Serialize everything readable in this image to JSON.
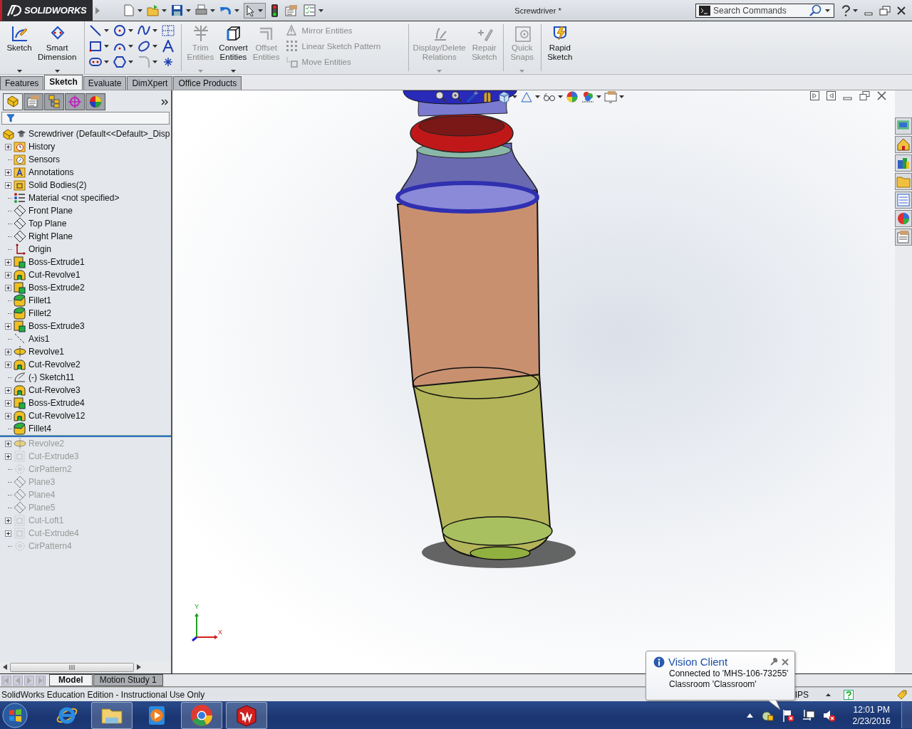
{
  "title_bar": {
    "logo": "SOLIDWORKS",
    "document_title": "Screwdriver *",
    "search": {
      "placeholder": "Search Commands"
    }
  },
  "command_manager": [
    {
      "kind": "large",
      "label": "Sketch",
      "disabled": false,
      "dropdown": true
    },
    {
      "kind": "large",
      "label": "Smart Dimension",
      "disabled": false,
      "dropdown": true
    },
    {
      "kind": "grid"
    },
    {
      "kind": "large",
      "label": "Trim Entities",
      "disabled": true,
      "dropdown": true
    },
    {
      "kind": "large",
      "label": "Convert Entities",
      "disabled": false,
      "dropdown": true
    },
    {
      "kind": "large",
      "label": "Offset Entities",
      "disabled": true,
      "dropdown": false
    },
    {
      "kind": "stack",
      "items": [
        {
          "label": "Mirror Entities",
          "disabled": true
        },
        {
          "label": "Linear Sketch Pattern",
          "disabled": true
        },
        {
          "label": "Move Entities",
          "disabled": true
        }
      ]
    },
    {
      "kind": "large",
      "label": "Display/Delete Relations",
      "disabled": true,
      "dropdown": true
    },
    {
      "kind": "large",
      "label": "Repair Sketch",
      "disabled": true,
      "dropdown": false
    },
    {
      "kind": "large",
      "label": "Quick Snaps",
      "disabled": true,
      "dropdown": true
    },
    {
      "kind": "large",
      "label": "Rapid Sketch",
      "disabled": false,
      "dropdown": false
    }
  ],
  "command_tabs": [
    {
      "label": "Features",
      "selected": false
    },
    {
      "label": "Sketch",
      "selected": true
    },
    {
      "label": "Evaluate",
      "selected": false
    },
    {
      "label": "DimXpert",
      "selected": false
    },
    {
      "label": "Office Products",
      "selected": false
    }
  ],
  "panel_tabs": [
    {
      "kind": "tree",
      "selected": true
    },
    {
      "kind": "property",
      "selected": false
    },
    {
      "kind": "config",
      "selected": false
    },
    {
      "kind": "dimxpert",
      "selected": false
    },
    {
      "kind": "display",
      "selected": false
    }
  ],
  "feature_tree": {
    "label": "Screwdriver  (Default<<Default>_Disp",
    "children": [
      {
        "label": "History",
        "kind": "history",
        "expandable": true,
        "rolled_back": false
      },
      {
        "label": "Sensors",
        "kind": "sensors",
        "expandable": false,
        "rolled_back": false
      },
      {
        "label": "Annotations",
        "kind": "annotations",
        "expandable": true,
        "rolled_back": false
      },
      {
        "label": "Solid Bodies(2)",
        "kind": "bodies",
        "expandable": true,
        "rolled_back": false
      },
      {
        "label": "Material <not specified>",
        "kind": "material",
        "expandable": false,
        "rolled_back": false
      },
      {
        "label": "Front Plane",
        "kind": "plane",
        "expandable": false,
        "rolled_back": false
      },
      {
        "label": "Top Plane",
        "kind": "plane",
        "expandable": false,
        "rolled_back": false
      },
      {
        "label": "Right Plane",
        "kind": "plane",
        "expandable": false,
        "rolled_back": false
      },
      {
        "label": "Origin",
        "kind": "origin",
        "expandable": false,
        "rolled_back": false
      },
      {
        "label": "Boss-Extrude1",
        "kind": "extrude",
        "expandable": true,
        "rolled_back": false
      },
      {
        "label": "Cut-Revolve1",
        "kind": "cutrevolve",
        "expandable": true,
        "rolled_back": false
      },
      {
        "label": "Boss-Extrude2",
        "kind": "extrude",
        "expandable": true,
        "rolled_back": false
      },
      {
        "label": "Fillet1",
        "kind": "fillet",
        "expandable": false,
        "rolled_back": false
      },
      {
        "label": "Fillet2",
        "kind": "fillet",
        "expandable": false,
        "rolled_back": false
      },
      {
        "label": "Boss-Extrude3",
        "kind": "extrude",
        "expandable": true,
        "rolled_back": false
      },
      {
        "label": "Axis1",
        "kind": "axis",
        "expandable": false,
        "rolled_back": false
      },
      {
        "label": "Revolve1",
        "kind": "revolve",
        "expandable": true,
        "rolled_back": false
      },
      {
        "label": "Cut-Revolve2",
        "kind": "cutrevolve",
        "expandable": true,
        "rolled_back": false
      },
      {
        "label": "(-) Sketch11",
        "kind": "sketch",
        "expandable": false,
        "rolled_back": false
      },
      {
        "label": "Cut-Revolve3",
        "kind": "cutrevolve",
        "expandable": true,
        "rolled_back": false
      },
      {
        "label": "Boss-Extrude4",
        "kind": "extrude",
        "expandable": true,
        "rolled_back": false
      },
      {
        "label": "Cut-Revolve12",
        "kind": "cutrevolve",
        "expandable": true,
        "rolled_back": false
      },
      {
        "label": "Fillet4",
        "kind": "fillet",
        "expandable": false,
        "rolled_back": false
      },
      {
        "label": "Revolve2",
        "kind": "revolve",
        "expandable": true,
        "rolled_back": true
      },
      {
        "label": "Cut-Extrude3",
        "kind": "cutextrude",
        "expandable": true,
        "rolled_back": true
      },
      {
        "label": "CirPattern2",
        "kind": "cirpattern",
        "expandable": false,
        "rolled_back": true
      },
      {
        "label": "Plane3",
        "kind": "plane",
        "expandable": false,
        "rolled_back": true
      },
      {
        "label": "Plane4",
        "kind": "plane",
        "expandable": false,
        "rolled_back": true
      },
      {
        "label": "Plane5",
        "kind": "plane",
        "expandable": false,
        "rolled_back": true
      },
      {
        "label": "Cut-Loft1",
        "kind": "cutextrude",
        "expandable": true,
        "rolled_back": true
      },
      {
        "label": "Cut-Extrude4",
        "kind": "cutextrude",
        "expandable": true,
        "rolled_back": true
      },
      {
        "label": "CirPattern4",
        "kind": "cirpattern",
        "expandable": false,
        "rolled_back": true
      }
    ]
  },
  "triad": {
    "y_label": "Y",
    "x_label": "X"
  },
  "bottom_tabs": [
    {
      "label": "Model",
      "selected": true
    },
    {
      "label": "Motion Study 1",
      "selected": false
    }
  ],
  "status_bar": {
    "message": "SolidWorks Education Edition - Instructional Use Only",
    "units": "IPS"
  },
  "notification": {
    "title": "Vision Client",
    "lines": [
      "Connected to 'MHS-106-73255'",
      "Classroom 'Classroom'"
    ]
  },
  "taskbar": {
    "apps": [
      {
        "kind": "ie",
        "running": false
      },
      {
        "kind": "explorer",
        "running": true
      },
      {
        "kind": "media",
        "running": false
      },
      {
        "kind": "chrome",
        "running": true
      },
      {
        "kind": "solidworks",
        "running": true
      }
    ],
    "clock": {
      "time": "12:01 PM",
      "date": "2/23/2016"
    }
  }
}
